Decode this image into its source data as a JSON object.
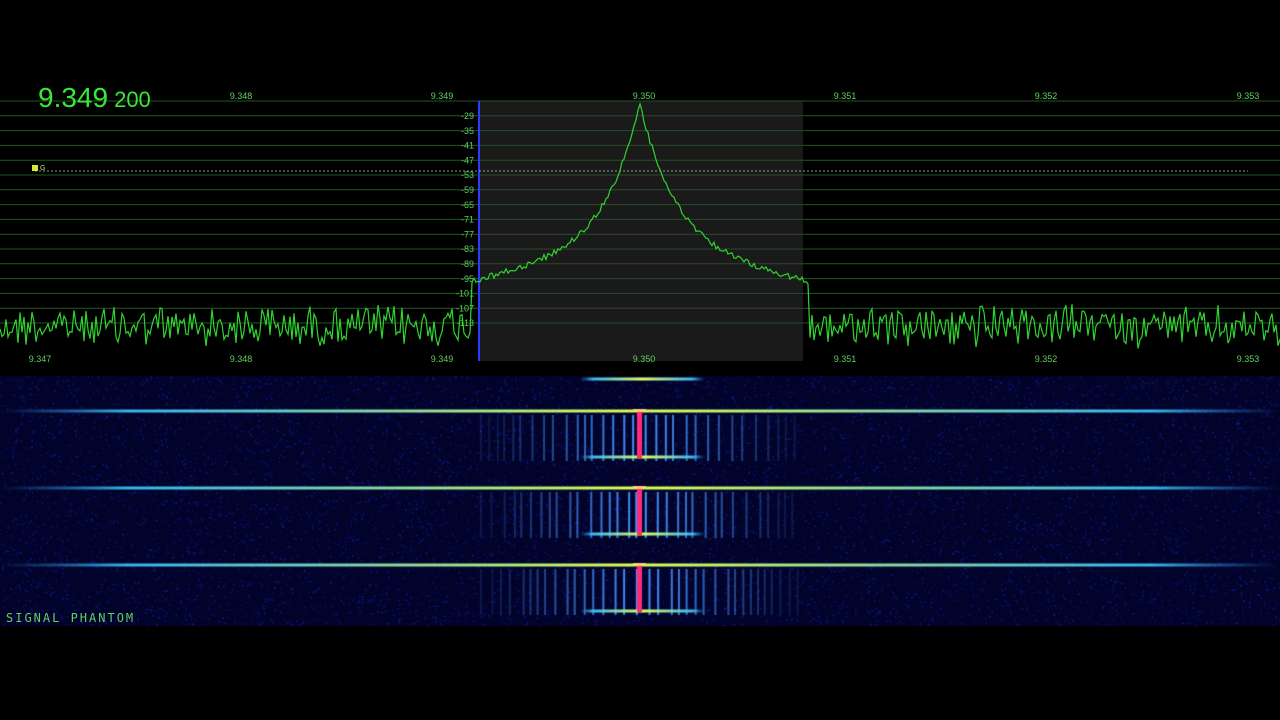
{
  "readout": {
    "mhz": "9.349",
    "hz": "200"
  },
  "freq_ticks": [
    "9.347",
    "9.348",
    "9.349",
    "9.350",
    "9.351",
    "9.352",
    "9.353"
  ],
  "db_ticks": [
    "-29",
    "-35",
    "-41",
    "-47",
    "-53",
    "-59",
    "-65",
    "-71",
    "-77",
    "-83",
    "-89",
    "-95",
    "-101",
    "-107",
    "-113"
  ],
  "marker_label": "G",
  "brand": "SIGNAL PHANTOM",
  "colors": {
    "trace": "#2fd42f",
    "grid": "#1c5a1c",
    "label": "#5fd05f",
    "passband": "#3a3a3a",
    "carrier": "#ff2a7a"
  }
}
